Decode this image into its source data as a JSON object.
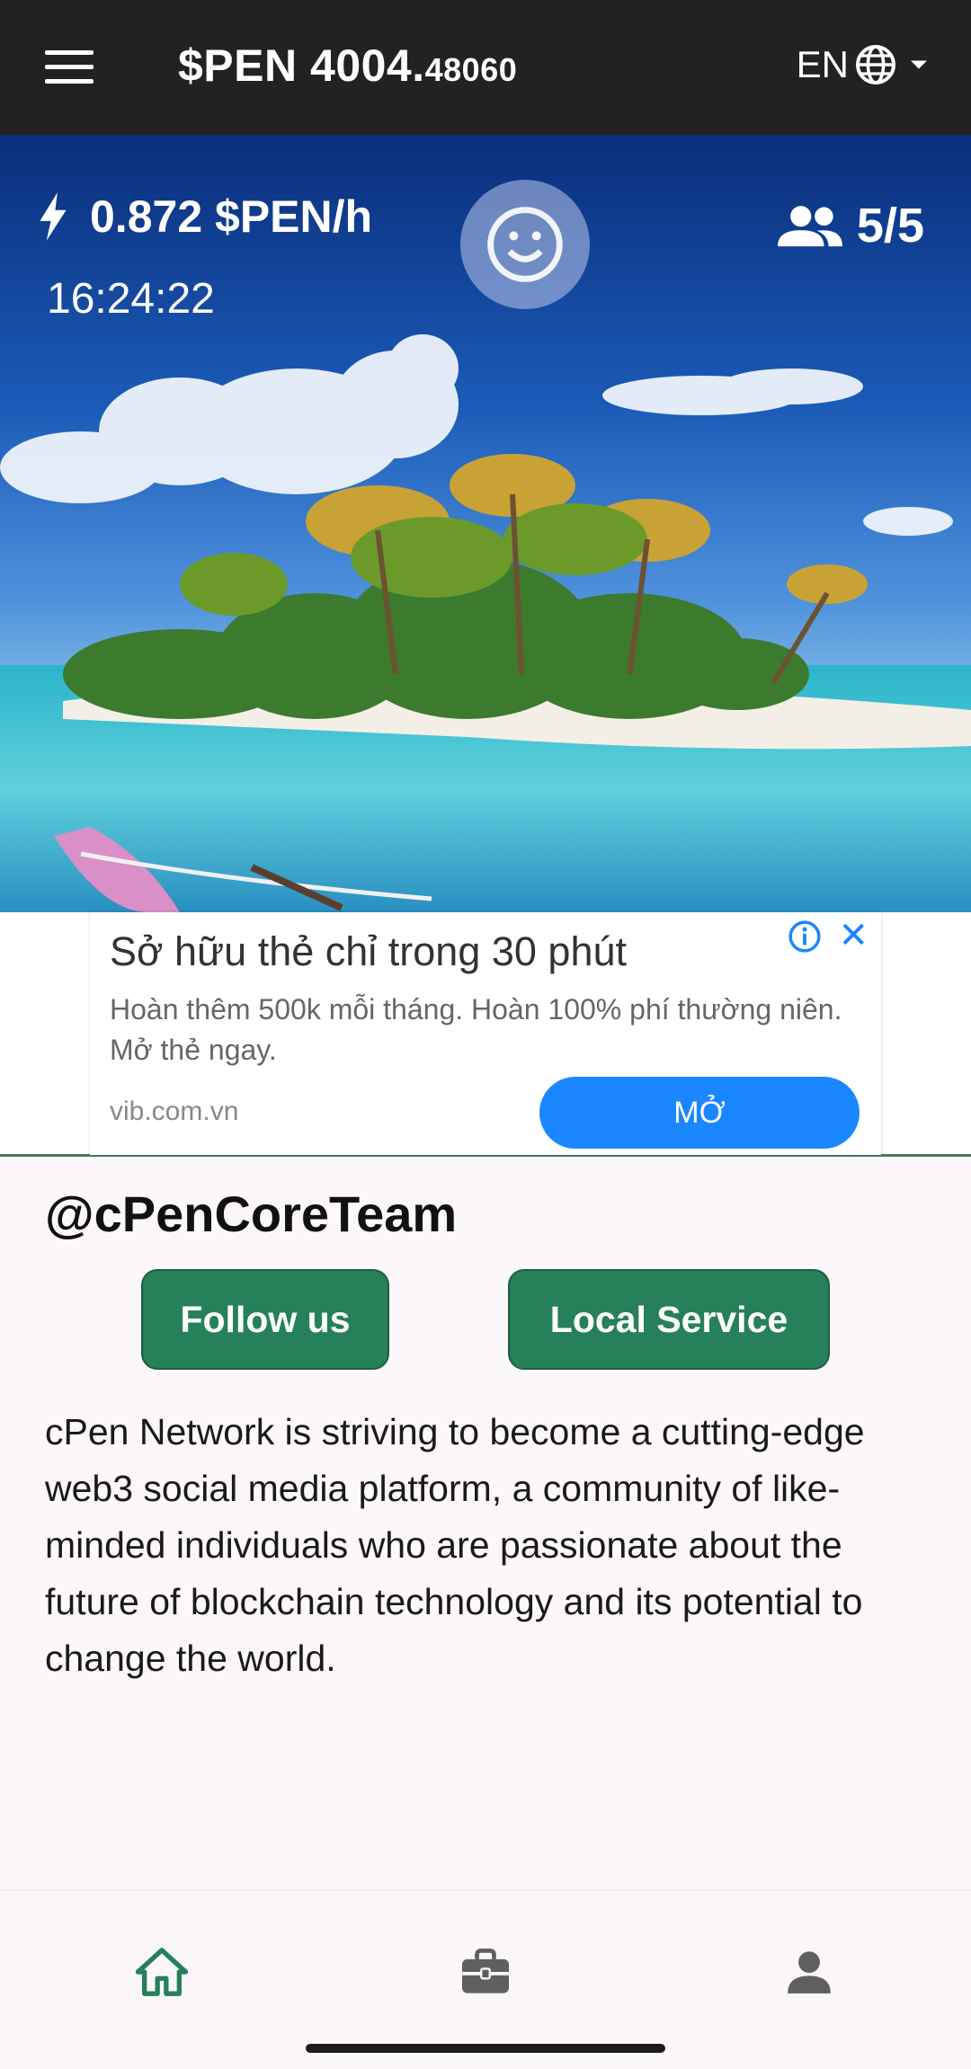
{
  "appbar": {
    "balance_main": "$PEN 4004.",
    "balance_decimals": "48060",
    "language": "EN"
  },
  "hero": {
    "mining_rate": "0.872 $PEN/h",
    "timer": "16:24:22",
    "referrals": "5/5"
  },
  "ad": {
    "title": "Sở hữu thẻ chỉ trong 30 phút",
    "description": "Hoàn thêm 500k mỗi tháng. Hoàn 100% phí thường niên. Mở thẻ ngay.",
    "domain": "vib.com.vn",
    "cta_label": "MỞ",
    "close_label": "✕"
  },
  "profile": {
    "handle": "@cPenCoreTeam",
    "follow_label": "Follow us",
    "local_service_label": "Local Service",
    "description": "cPen Network is striving to become a cutting-edge web3 social media platform, a community of like-minded individuals who are passionate about the future of blockchain technology and its potential to change the world."
  },
  "icons": {
    "menu": "hamburger-icon",
    "language": "globe-icon",
    "dropdown": "caret-down-icon",
    "rate": "lightning-icon",
    "mine": "smiley-icon",
    "referrals": "people-icon",
    "home": "home-icon",
    "work": "briefcase-icon",
    "profile": "person-icon",
    "ad_info": "info-icon"
  },
  "colors": {
    "appbar": "#222222",
    "primary_green": "#26805a",
    "ad_cta": "#1a86ff",
    "nav_active": "#26805a",
    "nav_inactive": "#5f5f5f"
  }
}
